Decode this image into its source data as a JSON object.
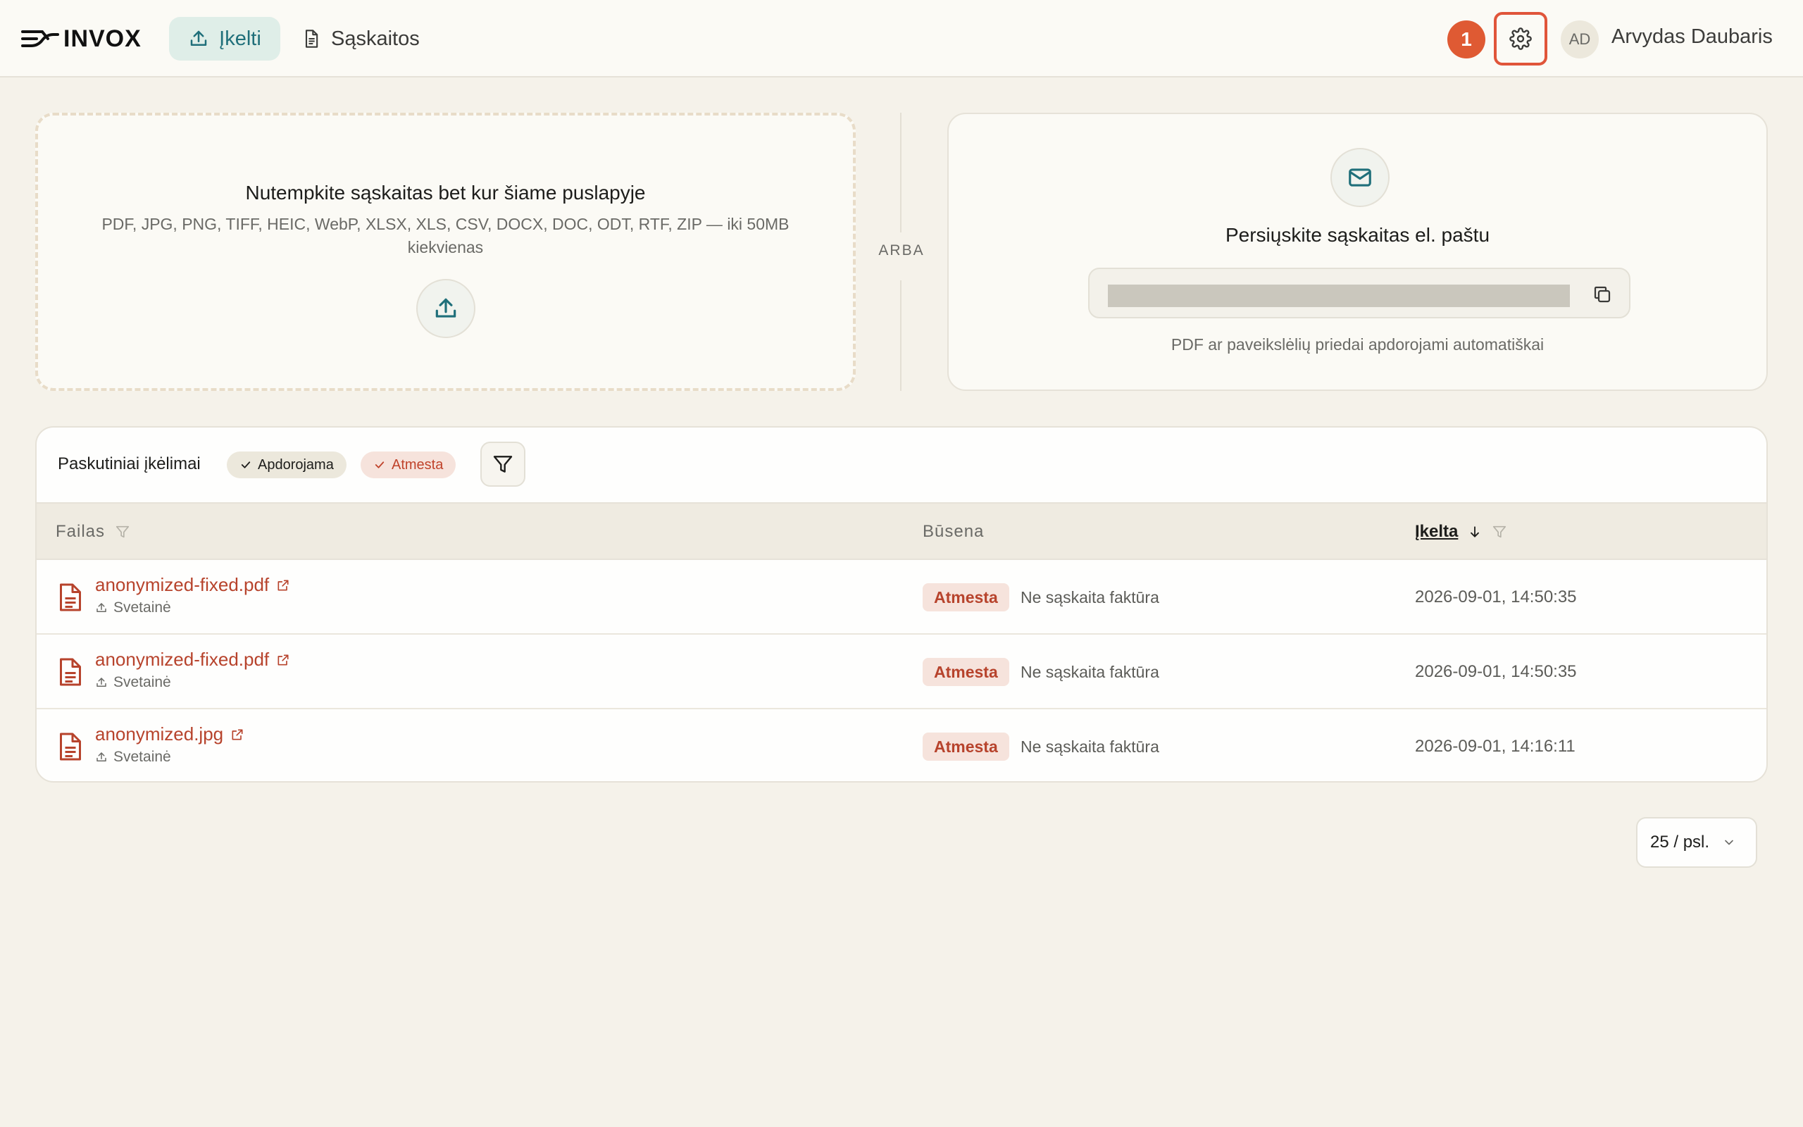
{
  "header": {
    "logo_text": "INVOX",
    "nav": {
      "upload_label": "Įkelti",
      "invoices_label": "Sąskaitos"
    },
    "notification_count": "1",
    "user": {
      "initials": "AD",
      "name": "Arvydas Daubaris"
    }
  },
  "dropzone": {
    "title": "Nutempkite sąskaitas bet kur šiame puslapyje",
    "formats": "PDF, JPG, PNG, TIFF, HEIC, WebP, XLSX, XLS, CSV, DOCX, DOC, ODT, RTF, ZIP — iki 50MB kiekvienas"
  },
  "divider_text": "ARBA",
  "email_card": {
    "title": "Persiųskite sąskaitas el. paštu",
    "note": "PDF ar paveikslėlių priedai apdorojami automatiškai"
  },
  "uploads": {
    "title": "Paskutiniai įkėlimai",
    "filter_chips": [
      "Apdorojama",
      "Atmesta"
    ],
    "columns": {
      "file": "Failas",
      "status": "Būsena",
      "uploaded": "Įkelta"
    },
    "rows": [
      {
        "file": "anonymized-fixed.pdf",
        "source": "Svetainė",
        "status": "Atmesta",
        "reason": "Ne sąskaita faktūra",
        "uploaded": "2026-09-01, 14:50:35"
      },
      {
        "file": "anonymized-fixed.pdf",
        "source": "Svetainė",
        "status": "Atmesta",
        "reason": "Ne sąskaita faktūra",
        "uploaded": "2026-09-01, 14:50:35"
      },
      {
        "file": "anonymized.jpg",
        "source": "Svetainė",
        "status": "Atmesta",
        "reason": "Ne sąskaita faktūra",
        "uploaded": "2026-09-01, 14:16:11"
      }
    ]
  },
  "pagination": {
    "page_size": "25 / psl."
  },
  "colors": {
    "accent": "#1f6f7a",
    "danger": "#b7432c",
    "notification": "#df5a33",
    "background": "#f5f2ea"
  },
  "icons": [
    "invox-logo-icon",
    "upload-icon",
    "document-icon",
    "gear-icon",
    "mail-icon",
    "copy-icon",
    "check-icon",
    "filter-icon",
    "sort-down-icon",
    "file-icon",
    "external-link-icon",
    "chevron-down-icon"
  ]
}
